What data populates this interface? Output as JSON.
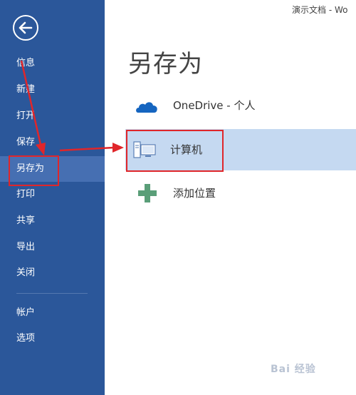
{
  "window": {
    "doc_title": "演示文档 - Wo"
  },
  "sidebar": {
    "back_icon": "back-arrow-icon",
    "items": [
      {
        "label": "信息"
      },
      {
        "label": "新建"
      },
      {
        "label": "打开"
      },
      {
        "label": "保存"
      },
      {
        "label": "另存为",
        "active": true
      },
      {
        "label": "打印"
      },
      {
        "label": "共享"
      },
      {
        "label": "导出"
      },
      {
        "label": "关闭"
      },
      {
        "label": "帐户"
      },
      {
        "label": "选项"
      }
    ]
  },
  "main": {
    "title": "另存为",
    "places": [
      {
        "label": "OneDrive - 个人",
        "icon": "onedrive-cloud-icon"
      },
      {
        "label": "计算机",
        "icon": "computer-icon",
        "selected": true
      },
      {
        "label": "添加位置",
        "icon": "add-plus-icon"
      }
    ]
  },
  "colors": {
    "sidebar_bg": "#2b579a",
    "sidebar_active": "#466fb2",
    "selected_row": "#c5d9f1",
    "annotation_red": "#e0262a"
  },
  "watermark": "Bai 经验"
}
